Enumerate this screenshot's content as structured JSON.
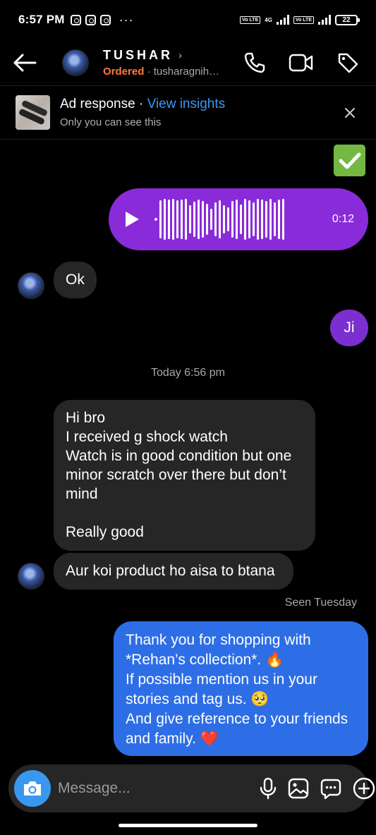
{
  "status_bar": {
    "time": "6:57 PM",
    "dots": "···",
    "volte1": "Vo LTE",
    "net_type": "4G",
    "volte2": "Vo LTE",
    "battery": "22"
  },
  "header": {
    "name": "TUSHAR",
    "chevron": "›",
    "status": "Ordered",
    "separator": " · ",
    "username": "tusharagnih…",
    "icons": [
      "back-arrow-icon",
      "phone-icon",
      "video-camera-icon",
      "tag-icon"
    ]
  },
  "ad_banner": {
    "title": "Ad response",
    "separator": " · ",
    "link": "View insights",
    "subtitle": "Only you can see this"
  },
  "messages": {
    "sent_check_emoji": "✅",
    "voice": {
      "duration": "0:12"
    },
    "ok": "Ok",
    "ji": "Ji",
    "day_stamp": "Today 6:56 pm",
    "incoming_long": {
      "line1": "Hi bro",
      "line2": "I received g shock watch",
      "line3": "Watch is in good condition but one",
      "line4": "minor scratch over there but don’t",
      "line5": "mind",
      "line6": "Really good"
    },
    "incoming_short": "Aur koi product ho aisa to btana",
    "seen": "Seen Tuesday",
    "outgoing_long": {
      "line1": "Thank you for shopping with",
      "line2": "*Rehan’s collection*. 🔥",
      "line3": "If possible mention us in your",
      "line4": "stories and tag us. 🥺",
      "line5": "And give reference to your friends",
      "line6": "and family. ❤️"
    }
  },
  "composer": {
    "placeholder": "Message...",
    "icons": [
      "camera-icon",
      "microphone-icon",
      "gallery-icon",
      "sticker-icon",
      "plus-icon"
    ]
  },
  "colors": {
    "background": "#000000",
    "incoming_bubble": "#262626",
    "voice_bubble": "#8a2bd9",
    "outgoing_purple": "#7b2fd0",
    "outgoing_blue": "#2d6ee6",
    "link": "#3d97f5",
    "ordered": "#ff7a3a",
    "camera_button": "#3a97f0"
  }
}
